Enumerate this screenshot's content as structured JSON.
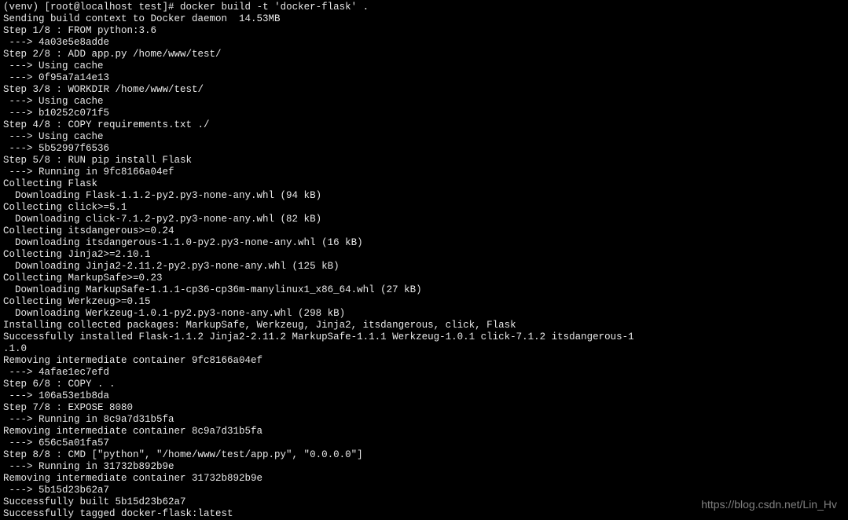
{
  "prompt": "(venv) [root@localhost test]# ",
  "command": "docker build -t 'docker-flask' .",
  "lines": [
    "Sending build context to Docker daemon  14.53MB",
    "Step 1/8 : FROM python:3.6",
    " ---> 4a03e5e8adde",
    "Step 2/8 : ADD app.py /home/www/test/",
    " ---> Using cache",
    " ---> 0f95a7a14e13",
    "Step 3/8 : WORKDIR /home/www/test/",
    " ---> Using cache",
    " ---> b10252c071f5",
    "Step 4/8 : COPY requirements.txt ./",
    " ---> Using cache",
    " ---> 5b52997f6536",
    "Step 5/8 : RUN pip install Flask",
    " ---> Running in 9fc8166a04ef",
    "Collecting Flask",
    "  Downloading Flask-1.1.2-py2.py3-none-any.whl (94 kB)",
    "Collecting click>=5.1",
    "  Downloading click-7.1.2-py2.py3-none-any.whl (82 kB)",
    "Collecting itsdangerous>=0.24",
    "  Downloading itsdangerous-1.1.0-py2.py3-none-any.whl (16 kB)",
    "Collecting Jinja2>=2.10.1",
    "  Downloading Jinja2-2.11.2-py2.py3-none-any.whl (125 kB)",
    "Collecting MarkupSafe>=0.23",
    "  Downloading MarkupSafe-1.1.1-cp36-cp36m-manylinux1_x86_64.whl (27 kB)",
    "Collecting Werkzeug>=0.15",
    "  Downloading Werkzeug-1.0.1-py2.py3-none-any.whl (298 kB)",
    "Installing collected packages: MarkupSafe, Werkzeug, Jinja2, itsdangerous, click, Flask",
    "Successfully installed Flask-1.1.2 Jinja2-2.11.2 MarkupSafe-1.1.1 Werkzeug-1.0.1 click-7.1.2 itsdangerous-1",
    ".1.0",
    "Removing intermediate container 9fc8166a04ef",
    " ---> 4afae1ec7efd",
    "Step 6/8 : COPY . .",
    " ---> 106a53e1b8da",
    "Step 7/8 : EXPOSE 8080",
    " ---> Running in 8c9a7d31b5fa",
    "Removing intermediate container 8c9a7d31b5fa",
    " ---> 656c5a01fa57",
    "Step 8/8 : CMD [\"python\", \"/home/www/test/app.py\", \"0.0.0.0\"]",
    " ---> Running in 31732b892b9e",
    "Removing intermediate container 31732b892b9e",
    " ---> 5b15d23b62a7",
    "Successfully built 5b15d23b62a7",
    "Successfully tagged docker-flask:latest"
  ],
  "watermark": "https://blog.csdn.net/Lin_Hv"
}
